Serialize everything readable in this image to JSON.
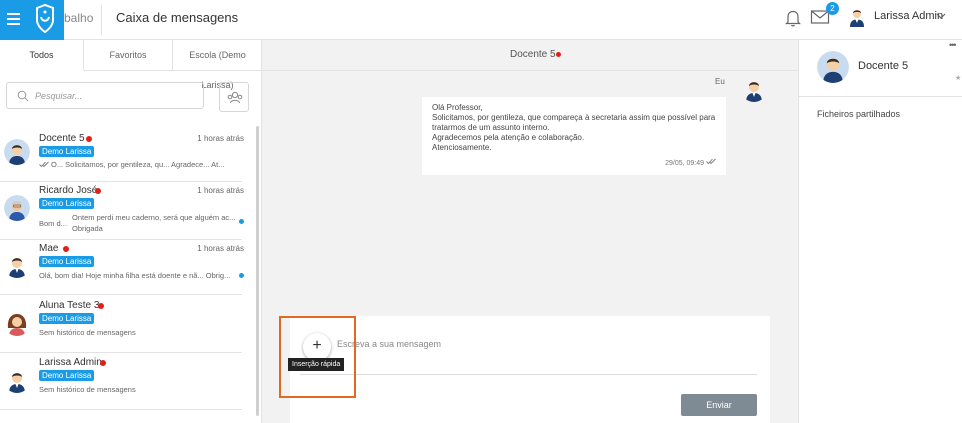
{
  "topbar": {
    "crumb_partial": "balho",
    "title": "Caixa de mensagens",
    "mail_badge": "2",
    "user_name": "Larissa Admin"
  },
  "left": {
    "tabs": [
      "Todos",
      "Favoritos",
      "Escola (Demo Larissa)"
    ],
    "search_placeholder": "Pesquisar...",
    "conversations": [
      {
        "name": "Docente 5",
        "time": "1 horas atrás",
        "school": "Demo Larissa",
        "preview": "O...   Solicitamos, por gentileza, qu...   Agradece...   At..."
      },
      {
        "name": "Ricardo José",
        "time": "1 horas atrás",
        "school": "Demo Larissa",
        "preview_a": "Bom d...",
        "preview_b": "Ontem perdi meu caderno, será que alguém ac...",
        "preview_c": "Obrigada"
      },
      {
        "name": "Mae",
        "time": "1 horas atrás",
        "school": "Demo Larissa",
        "preview": "Olá, bom dia! Hoje minha filha está doente e nã...   Obrig..."
      },
      {
        "name": "Aluna Teste 3",
        "school": "Demo Larissa",
        "preview": "Sem histórico de mensagens"
      },
      {
        "name": "Larissa Admin",
        "school": "Demo Larissa",
        "preview": "Sem histórico de mensagens"
      }
    ]
  },
  "chat": {
    "title": "Docente 5",
    "sender": "Eu",
    "message_lines": [
      "Olá Professor,",
      "Solicitamos, por gentileza, que compareça à secretaria assim que possível para",
      "tratarmos de um assunto interno.",
      "Agradecemos pela atenção e colaboração.",
      "Atenciosamente."
    ],
    "message_time": "29/05, 09:49",
    "compose_placeholder": "Escreva a sua mensagem",
    "plus_label": "+",
    "tooltip": "Inserção rápida",
    "send_label": "Enviar"
  },
  "right": {
    "dots": "•••",
    "name": "Docente 5",
    "star": "★",
    "files_label": "Ficheiros partilhados"
  },
  "colors": {
    "accent": "#1a9be6",
    "online": "#e0201a",
    "highlight": "#e06a24",
    "send": "#7f8b94"
  }
}
